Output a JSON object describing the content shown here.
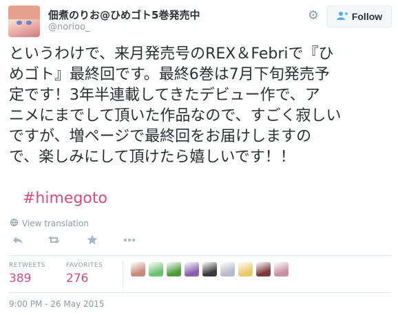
{
  "user": {
    "display_name": "佃煮のりお@ひめゴト5巻発売中",
    "handle": "@norioo_",
    "follow_label": "Follow"
  },
  "tweet": {
    "lines": [
      "というわけで、来月発売号のREX＆Febriで『ひ",
      "めゴト』最終回です。最終6巻は7月下旬発売予",
      "定です！3年半連載してきたデビュー作で、ア",
      "ニメにまでして頂いた作品なので、すごく寂しい",
      "ですが、増ページで最終回をお届けしますの",
      "で、楽しみにして頂けたら嬉しいです！！"
    ],
    "hashtag": "#himegoto"
  },
  "view_translation": "View translation",
  "stats": {
    "retweets_label": "RETWEETS",
    "retweets_value": "389",
    "favorites_label": "FAVORITES",
    "favorites_value": "276"
  },
  "timestamp": "9:00 PM - 26 May 2015",
  "colors": {
    "accent": "#55acee",
    "hashtag": "#d54c7a",
    "muted": "#8899a6",
    "divider": "#e1e8ed"
  },
  "icons": [
    "gear-icon",
    "follow-user-icon",
    "globe-icon",
    "reply-icon",
    "retweet-icon",
    "favorite-icon",
    "more-icon"
  ],
  "favoriter_avatars": [
    "#c98a7a",
    "#6fbf73",
    "#4d9a3b",
    "#8a5fb0",
    "#3a3a3a",
    "#b9b9c9",
    "#e8c86a",
    "#7a3b3b",
    "#c98f9f"
  ]
}
